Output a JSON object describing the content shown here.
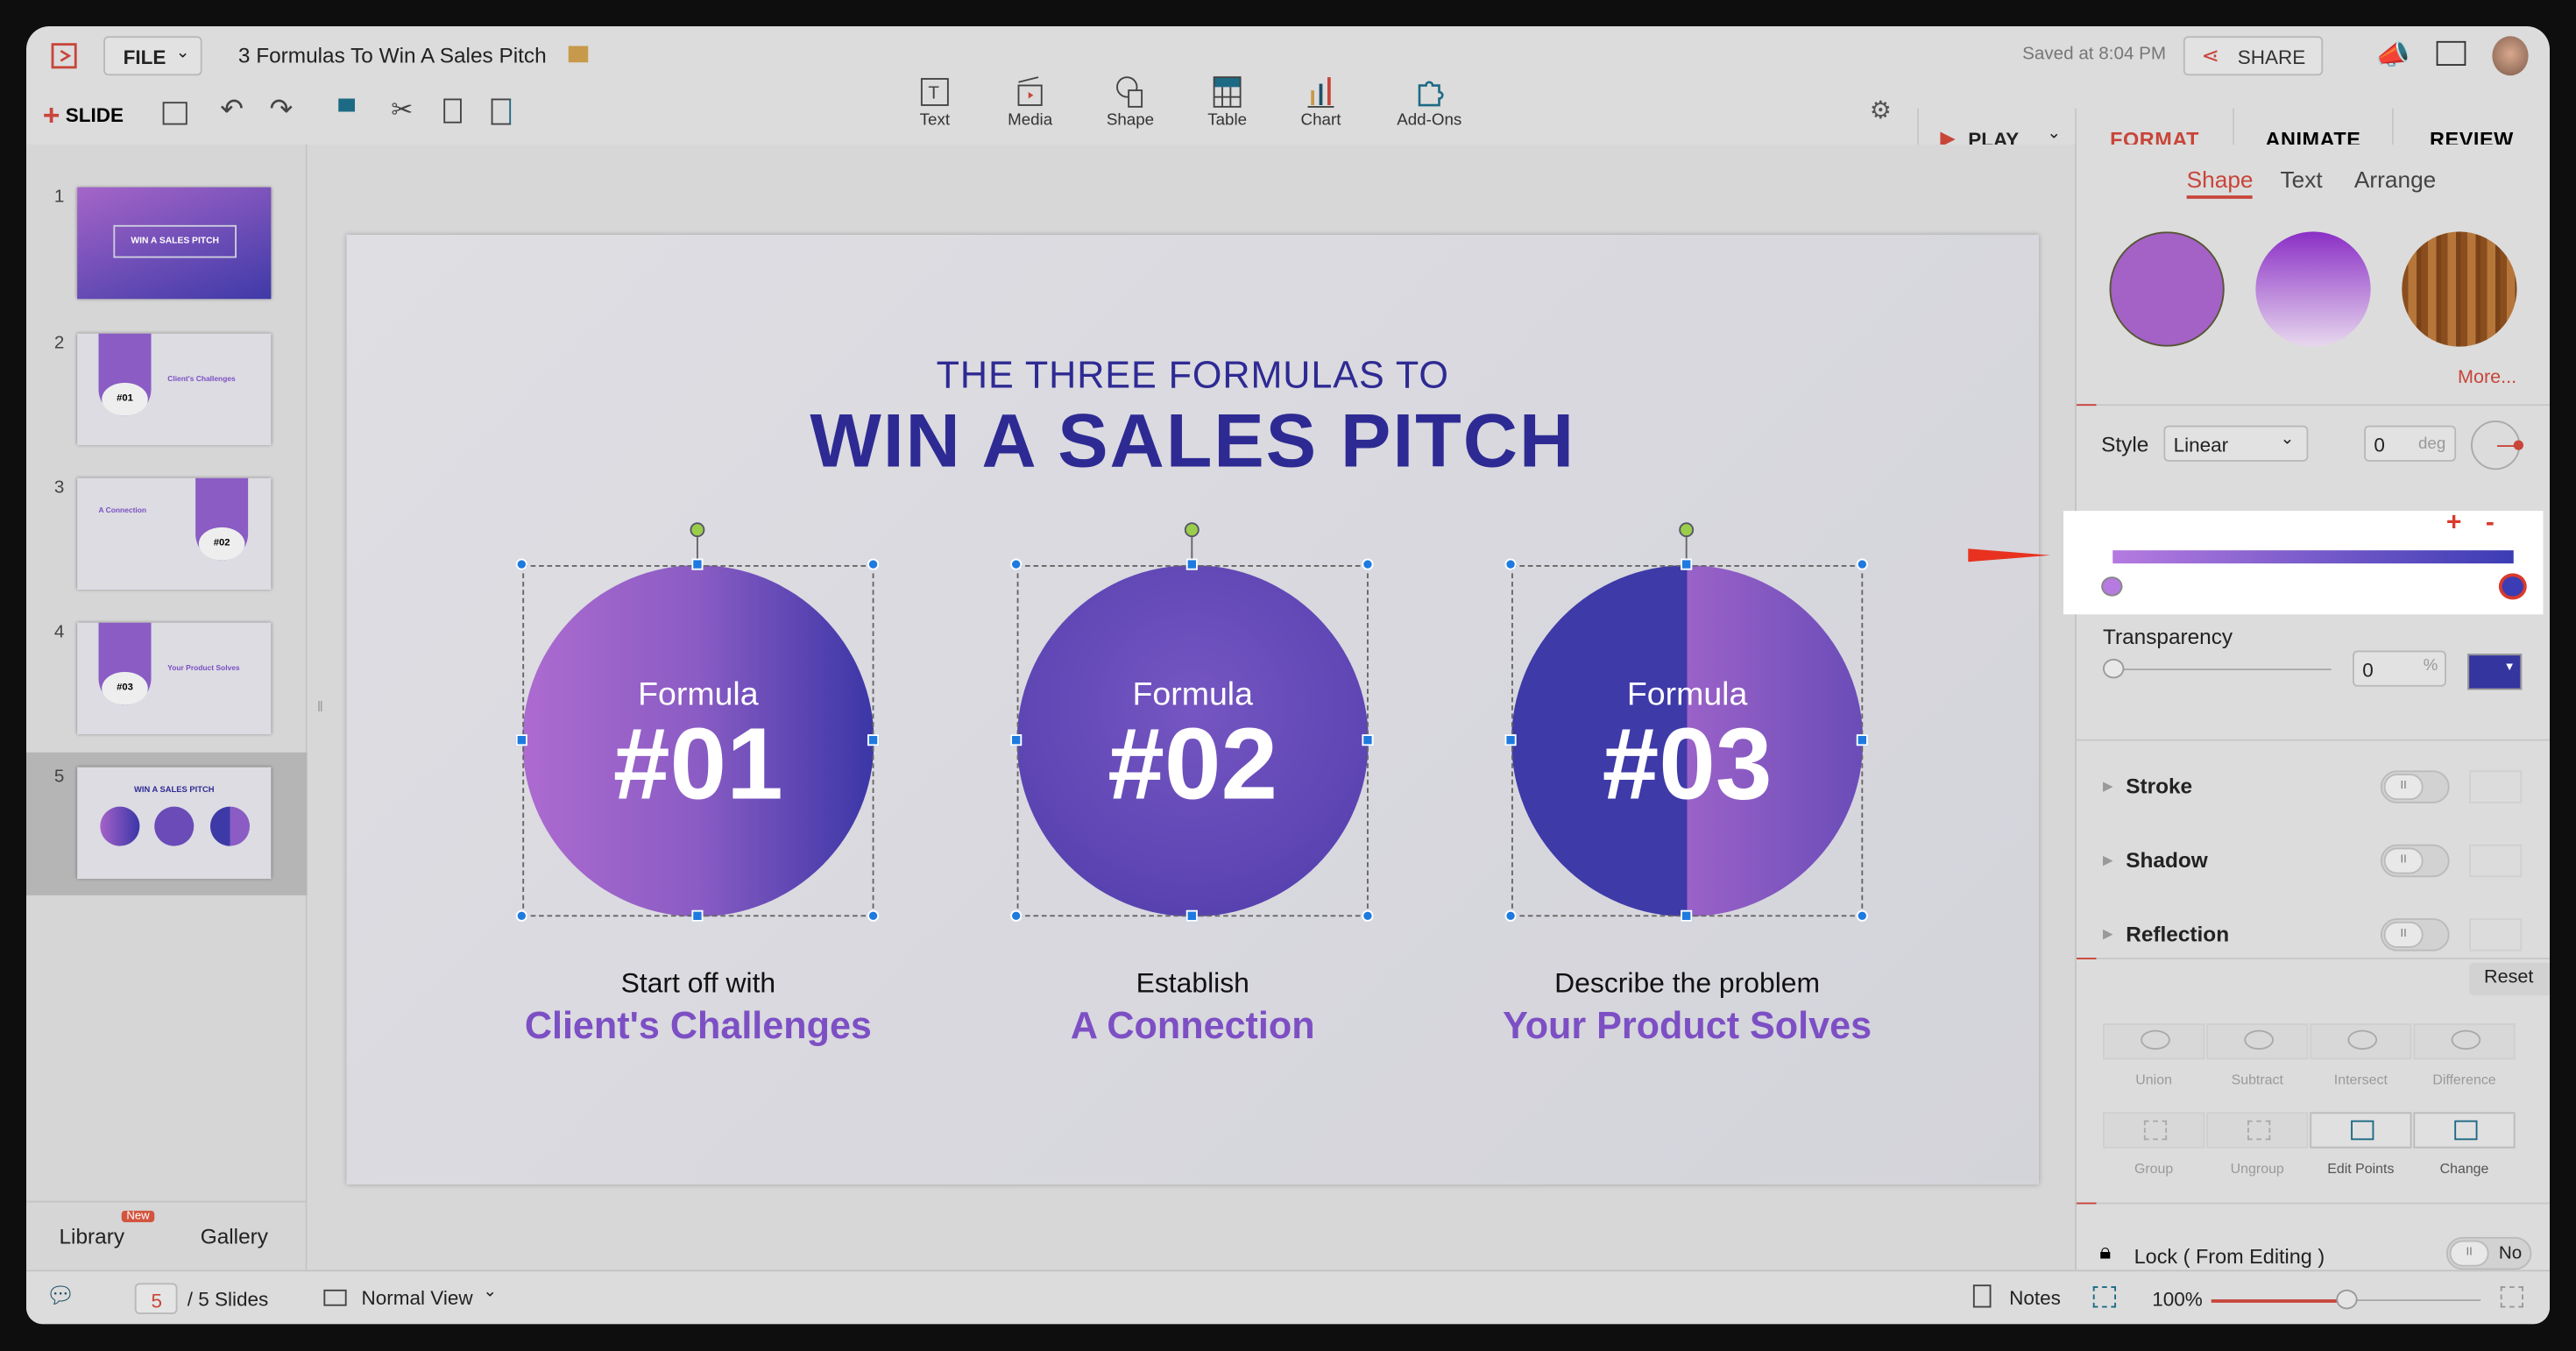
{
  "header": {
    "file_label": "FILE",
    "doc_title": "3 Formulas To Win A Sales Pitch",
    "saved_status": "Saved at 8:04 PM",
    "share_label": "SHARE"
  },
  "toolbar": {
    "slide_label": "SLIDE",
    "insert": [
      {
        "label": "Text",
        "icon": "text-box-icon"
      },
      {
        "label": "Media",
        "icon": "clapper-icon"
      },
      {
        "label": "Shape",
        "icon": "shape-icon"
      },
      {
        "label": "Table",
        "icon": "table-icon"
      },
      {
        "label": "Chart",
        "icon": "bar-chart-icon"
      },
      {
        "label": "Add-Ons",
        "icon": "puzzle-icon"
      }
    ],
    "play_label": "PLAY"
  },
  "tabs": [
    {
      "label": "FORMAT",
      "active": true
    },
    {
      "label": "ANIMATE"
    },
    {
      "label": "REVIEW"
    }
  ],
  "slides_panel": {
    "thumbs": [
      {
        "num": "1",
        "title": "WIN A SALES PITCH"
      },
      {
        "num": "2",
        "badge": "#01",
        "title": "Client's Challenges"
      },
      {
        "num": "3",
        "badge": "#02",
        "title": "A Connection"
      },
      {
        "num": "4",
        "badge": "#03",
        "title": "Your Product Solves"
      },
      {
        "num": "5",
        "title": "WIN A SALES PITCH",
        "selected": true
      }
    ],
    "library_label": "Library",
    "new_badge": "New",
    "gallery_label": "Gallery"
  },
  "slide": {
    "kicker": "THE THREE FORMULAS TO",
    "title": "WIN A SALES PITCH",
    "formulas": [
      {
        "word": "Formula",
        "num": "#01",
        "line1": "Start off with",
        "line2": "Client's Challenges"
      },
      {
        "word": "Formula",
        "num": "#02",
        "line1": "Establish",
        "line2": "A Connection"
      },
      {
        "word": "Formula",
        "num": "#03",
        "line1": "Describe the problem",
        "line2": "Your Product Solves"
      }
    ]
  },
  "format_panel": {
    "subtabs": [
      {
        "label": "Shape",
        "active": true
      },
      {
        "label": "Text"
      },
      {
        "label": "Arrange"
      }
    ],
    "more_label": "More...",
    "style_label": "Style",
    "style_value": "Linear",
    "angle_value": "0",
    "angle_unit": "deg",
    "gradient": {
      "start": "#b57be0",
      "end": "#3c3cb4",
      "plus": "+",
      "minus": "-"
    },
    "transparency_label": "Transparency",
    "transparency_value": "0",
    "transparency_unit": "%",
    "fill_color": "#3535a0",
    "sections": [
      "Stroke",
      "Shadow",
      "Reflection"
    ],
    "reset_label": "Reset",
    "boolean_ops": [
      "Union",
      "Subtract",
      "Intersect",
      "Difference"
    ],
    "group_ops": [
      "Group",
      "Ungroup",
      "Edit Points",
      "Change"
    ],
    "lock_label": "Lock ( From Editing )",
    "lock_value": "No"
  },
  "status": {
    "current_page": "5",
    "total_label": "/ 5 Slides",
    "view_label": "Normal View",
    "notes_label": "Notes",
    "zoom_label": "100%",
    "zoom_level": 0.5
  },
  "colors": {
    "accent": "#d04a3a",
    "title": "#2e2a93",
    "caption": "#7d4fc4"
  }
}
